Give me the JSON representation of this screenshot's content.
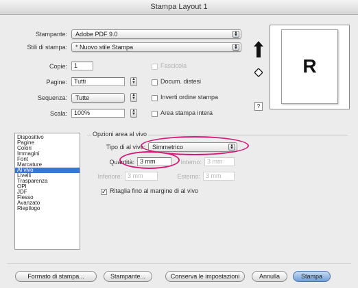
{
  "window": {
    "title": "Stampa Layout 1"
  },
  "printer": {
    "label": "Stampante:",
    "value": "Adobe PDF 9.0"
  },
  "print_style": {
    "label": "Stili di stampa:",
    "value": "* Nuovo stile Stampa"
  },
  "copies": {
    "label": "Copie:",
    "value": "1"
  },
  "pages": {
    "label": "Pagine:",
    "value": "Tutti"
  },
  "sequence": {
    "label": "Sequenza:",
    "value": "Tutte"
  },
  "scale": {
    "label": "Scala:",
    "value": "100%"
  },
  "checkboxes": {
    "collate": {
      "label": "Fascicola",
      "checked": false,
      "enabled": false
    },
    "spreads": {
      "label": "Docum. distesi",
      "checked": false,
      "enabled": true
    },
    "reverse": {
      "label": "Inverti ordine stampa",
      "checked": false,
      "enabled": true
    },
    "full_area": {
      "label": "Area stampa intera",
      "checked": false,
      "enabled": true
    }
  },
  "preview": {
    "help_label": "?",
    "page_letter": "R"
  },
  "sidebar": {
    "items": [
      {
        "label": "Dispositivo"
      },
      {
        "label": "Pagine"
      },
      {
        "label": "Colori"
      },
      {
        "label": "Immagini"
      },
      {
        "label": "Font"
      },
      {
        "label": "Marcature"
      },
      {
        "label": "Al vivo",
        "selected": true
      },
      {
        "label": "Livelli"
      },
      {
        "label": "Trasparenza"
      },
      {
        "label": "OPI"
      },
      {
        "label": "JDF"
      },
      {
        "label": "Flesso"
      },
      {
        "label": "Avanzato"
      },
      {
        "label": "Riepilogo"
      }
    ]
  },
  "bleed": {
    "group_title": "Opzioni area al vivo",
    "type": {
      "label": "Tipo di al vivo:",
      "value": "Simmetrico"
    },
    "amount": {
      "label": "Quantità:",
      "value": "3 mm"
    },
    "interno": {
      "label": "Interno:",
      "value": "3 mm"
    },
    "inferiore": {
      "label": "Inferiore:",
      "value": "3 mm"
    },
    "esterno": {
      "label": "Esterno:",
      "value": "3 mm"
    },
    "clip": {
      "label": "Ritaglia fino al margine di al vivo",
      "checked": true
    }
  },
  "buttons": {
    "page_setup": "Formato di stampa...",
    "printer": "Stampante...",
    "save_settings": "Conserva le impostazioni",
    "cancel": "Annulla",
    "print": "Stampa"
  },
  "highlight_color": "#d61a78",
  "accent_color": "#3875d7"
}
